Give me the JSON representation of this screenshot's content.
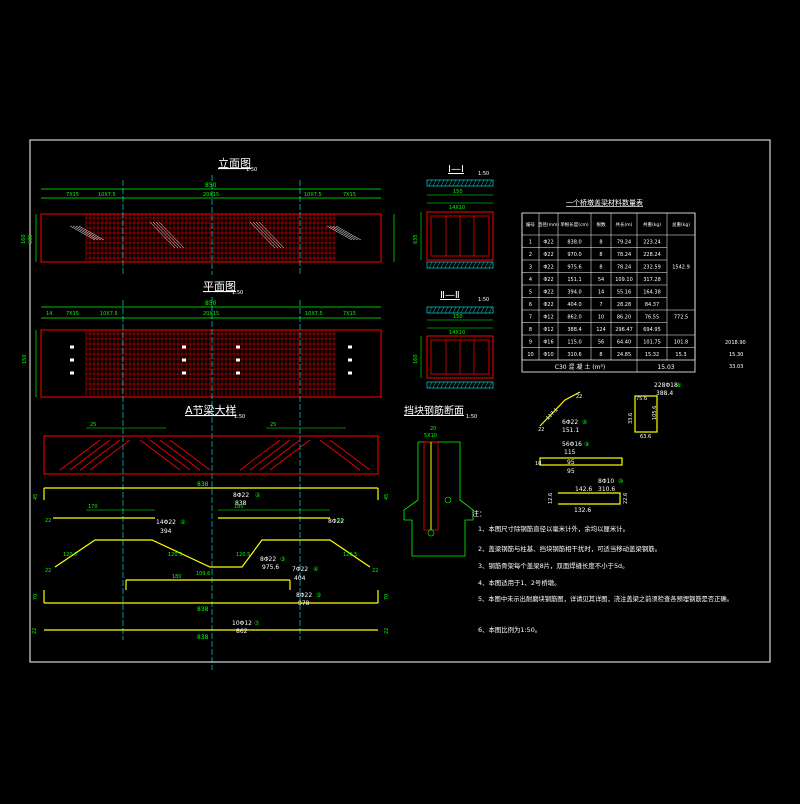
{
  "titles": {
    "elevation": "立面图",
    "elevation_scale": "1:50",
    "plan": "平面图",
    "plan_scale": "1:50",
    "section1": "Ⅰ—Ⅰ",
    "section1_scale": "1:50",
    "section2": "Ⅱ—Ⅱ",
    "section2_scale": "1:50",
    "rebar_detail": "A节梁大样",
    "rebar_detail_scale": "1:50",
    "block_section": "挡块钢筋断面",
    "block_section_scale": "1:50",
    "table_title": "一个桥墩盖梁材料数量表"
  },
  "dims": {
    "total_length": "850",
    "edge": "14",
    "d1": "7X15",
    "d2": "10X7.5",
    "d3": "20X15",
    "h1": "160",
    "h2": "635",
    "sec_width": "150",
    "sec_inner": "14X10",
    "block_20": "20",
    "block_5x10": "5X10"
  },
  "rebar": {
    "r1_len": "838",
    "r1_lbl": "8Φ22",
    "r1_sub": "②",
    "r1_tot": "838",
    "r2_lbl": "14Φ22",
    "r2_sub": "②",
    "r2_tot": "394",
    "r3_lbl": "8Φ22",
    "r3_sub": "③",
    "r3_tot": "975.6",
    "r4_lbl": "7Φ22",
    "r4_sub": "④",
    "r4_tot": "404",
    "r5_lbl": "8Φ22",
    "r5_sub": "⑤",
    "r5_tot": "978",
    "r6_lbl": "10Φ12",
    "r6_sub": "⑦",
    "r6_tot": "862",
    "v45": "45",
    "v22": "22",
    "v70": "70",
    "v120": "120.5",
    "v180": "180",
    "v109": "109.6",
    "v170": "170",
    "v25": "25"
  },
  "side_notes": [
    "2018.90",
    "15.30",
    "33.03"
  ],
  "table": {
    "headers": [
      "编号",
      "直径(mm)",
      "单根长度(cm)",
      "根数",
      "共长(m)",
      "共重(kg)",
      "总重(kg)"
    ],
    "rows": [
      [
        "1",
        "Φ22",
        "838.0",
        "8",
        "79.24",
        "223.24",
        ""
      ],
      [
        "2",
        "Φ22",
        "970.0",
        "8",
        "78.24",
        "228.24",
        ""
      ],
      [
        "3",
        "Φ22",
        "975.6",
        "8",
        "78.24",
        "232.59",
        "1542.9"
      ],
      [
        "4",
        "Φ22",
        "151.1",
        "54",
        "109.10",
        "317.28",
        ""
      ],
      [
        "5",
        "Φ22",
        "394.0",
        "14",
        "55.16",
        "164.38",
        ""
      ],
      [
        "6",
        "Φ22",
        "404.0",
        "7",
        "28.28",
        "84.37",
        ""
      ],
      [
        "7",
        "Φ12",
        "862.0",
        "10",
        "86.20",
        "76.55",
        "772.5"
      ],
      [
        "8",
        "Φ12",
        "388.4",
        "124",
        "296.47",
        "694.95",
        ""
      ],
      [
        "9",
        "Φ16",
        "115.0",
        "56",
        "64.40",
        "101.75",
        "101.8"
      ],
      [
        "10",
        "Φ10",
        "310.6",
        "8",
        "24.85",
        "15.32",
        "15.3"
      ]
    ],
    "footer_label": "C30 混 凝 土 (m³)",
    "footer_value": "15.03"
  },
  "bends": {
    "b1_a": "22",
    "b1_b": "117.1",
    "b1_c": "22",
    "b1_lbl": "6Φ22",
    "b1_sub": "④",
    "b1_tot": "151.1",
    "b2_a": "228Φ18",
    "b2_sub": "⑧",
    "b2_b": "388.4",
    "b2_c": "75.6",
    "b2_d": "105.6",
    "b2_e": "33.6",
    "b2_f": "63.6",
    "b3_lbl": "56Φ16",
    "b3_sub": "⑨",
    "b3_tot": "115",
    "b3_a": "10",
    "b3_b": "95",
    "b4_lbl": "8Φ10",
    "b4_sub": "⑩",
    "b4_tot": "310.6",
    "b4_a": "142.6",
    "b4_b": "12.6",
    "b4_c": "22.6",
    "b4_d": "132.6"
  },
  "notes_title": "注：",
  "notes": [
    "1、本图尺寸除钢筋直径以毫米计外，余均以厘米计。",
    "2、盖梁钢筋与柱基、挡块钢筋相干扰时，可适当移动盖梁钢筋。",
    "3、钢筋骨架每个盖梁8片，双面焊缝长度不小于5d。",
    "4、本图适用于1、2号桥墩。",
    "5、本图中未示出耐磨块钢筋图，详请见其详图，浇注盖梁之前须检查各预埋钢筋是否正确。",
    "6、本图比例为1:50。"
  ],
  "colors": {
    "bg": "#000000",
    "frame": "#ffffff",
    "concrete": "#ff0000",
    "rebar": "#ffff00",
    "dim": "#00ff00",
    "axis": "#00ffff",
    "hatch": "#00ffff"
  }
}
